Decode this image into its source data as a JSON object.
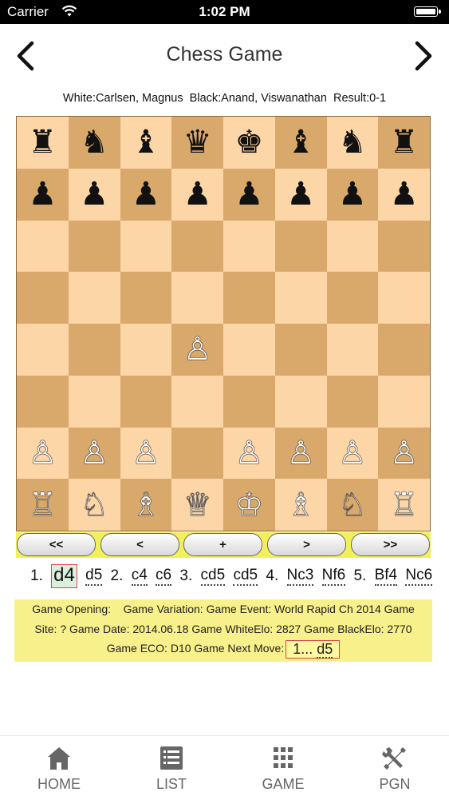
{
  "status": {
    "carrier": "Carrier",
    "time": "1:02 PM"
  },
  "nav": {
    "title": "Chess Game"
  },
  "game_info": "White:Carlsen, Magnus  Black:Anand, Viswanathan  Result:0-1",
  "board": {
    "rows": [
      [
        "♜",
        "♞",
        "♝",
        "♛",
        "♚",
        "♝",
        "♞",
        "♜"
      ],
      [
        "♟",
        "♟",
        "♟",
        "♟",
        "♟",
        "♟",
        "♟",
        "♟"
      ],
      [
        "",
        "",
        "",
        "",
        "",
        "",
        "",
        ""
      ],
      [
        "",
        "",
        "",
        "",
        "",
        "",
        "",
        ""
      ],
      [
        "",
        "",
        "",
        "♙",
        "",
        "",
        "",
        ""
      ],
      [
        "",
        "",
        "",
        "",
        "",
        "",
        "",
        ""
      ],
      [
        "♙",
        "♙",
        "♙",
        "",
        "♙",
        "♙",
        "♙",
        "♙"
      ],
      [
        "♖",
        "♘",
        "♗",
        "♕",
        "♔",
        "♗",
        "♘",
        "♖"
      ]
    ]
  },
  "controls": {
    "first": "<<",
    "prev": "<",
    "plus": "+",
    "next": ">",
    "last": ">>"
  },
  "moves": {
    "n1": "1.",
    "m1w": "d4",
    "m1b": "d5",
    "n2": "2.",
    "m2w": "c4",
    "m2b": "c6",
    "n3": "3.",
    "m3w": "cd5",
    "m3b": "cd5",
    "n4": "4.",
    "m4w": "Nc3",
    "m4b": "Nf6",
    "n5": "5.",
    "m5w": "Bf4",
    "m5b": "Nc6"
  },
  "details": {
    "line1": "Game Opening:    Game Variation: Game Event: World Rapid Ch 2014 Game",
    "line2": "Site: ? Game Date: 2014.06.18 Game WhiteElo: 2827 Game BlackElo: 2770",
    "line3": "Game ECO: D10 Game Next Move:",
    "next_num": "1...",
    "next_move": "d5"
  },
  "tabs": [
    {
      "label": "HOME",
      "icon": "home-icon"
    },
    {
      "label": "LIST",
      "icon": "list-icon"
    },
    {
      "label": "GAME",
      "icon": "grid-icon"
    },
    {
      "label": "PGN",
      "icon": "tools-icon"
    }
  ],
  "colors": {
    "light_square": "#fdd6a8",
    "dark_square": "#d9a86b",
    "controls_bg": "#f1f05a",
    "details_bg": "#f8f08a",
    "highlight_border": "#dd4444"
  }
}
